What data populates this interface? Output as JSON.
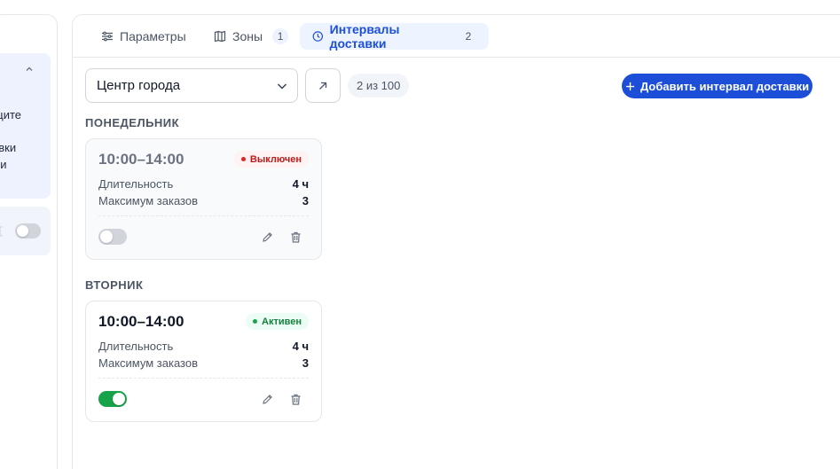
{
  "left_panel": {
    "text_line_1": "щите",
    "text_line_2": "авки",
    "text_line_3": "ри"
  },
  "tabs": [
    {
      "label": "Параметры",
      "icon": "sliders-icon",
      "count": null
    },
    {
      "label": "Зоны",
      "icon": "map-icon",
      "count": "1"
    },
    {
      "label": "Интервалы доставки",
      "icon": "clock-icon",
      "count": "2",
      "active": true
    }
  ],
  "toolbar": {
    "zone_select_value": "Центр города",
    "counter": "2 из 100",
    "add_button_label": "Добавить интервал доставки"
  },
  "days": [
    {
      "heading": "ПОНЕДЕЛЬНИК",
      "intervals": [
        {
          "time": "10:00–14:00",
          "status": "Выключен",
          "duration_label": "Длительность",
          "duration_value": "4 ч",
          "max_orders_label": "Максимум заказов",
          "max_orders_value": "3",
          "enabled": false
        }
      ]
    },
    {
      "heading": "ВТОРНИК",
      "intervals": [
        {
          "time": "10:00–14:00",
          "status": "Активен",
          "duration_label": "Длительность",
          "duration_value": "4 ч",
          "max_orders_label": "Максимум заказов",
          "max_orders_value": "3",
          "enabled": true
        }
      ]
    }
  ],
  "colors": {
    "accent": "#1d4ed8",
    "active_tab_bg": "#eef4ff",
    "status_off": "#dc2626",
    "status_on": "#16a34a"
  }
}
